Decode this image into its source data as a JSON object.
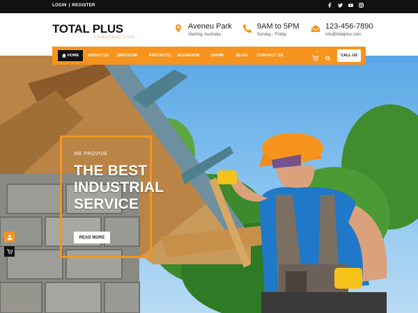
{
  "topbar": {
    "login": "LOGIN",
    "sep": "|",
    "register": "REGISTER",
    "social": [
      "facebook-icon",
      "twitter-icon",
      "youtube-icon",
      "instagram-icon"
    ]
  },
  "header": {
    "logo_main": "TOTAL PLUS",
    "logo_sub": "CONSTRUCTION",
    "location": {
      "title": "Aveneu Park",
      "sub": "Starling, Australia."
    },
    "hours": {
      "title": "9AM to 5PM",
      "sub": "Sunday - Friday"
    },
    "contact": {
      "title": "123-456-7890",
      "sub": "info@totalplus.com"
    }
  },
  "nav": {
    "home": "HOME",
    "items": [
      "ABOUT US",
      "SERVICES",
      "PROJECTS",
      "ELEMENTS",
      "SHOP",
      "BLOG",
      "CONTACT US"
    ],
    "cart_count": "0",
    "cta": "CALL US"
  },
  "hero": {
    "pre": "WE PROVIDE",
    "title_lines": [
      "THE BEST",
      "INDUSTRIAL",
      "SERVICE"
    ],
    "button": "READ MORE"
  },
  "colors": {
    "accent": "#f7941d",
    "dark": "#111111",
    "white": "#ffffff"
  }
}
